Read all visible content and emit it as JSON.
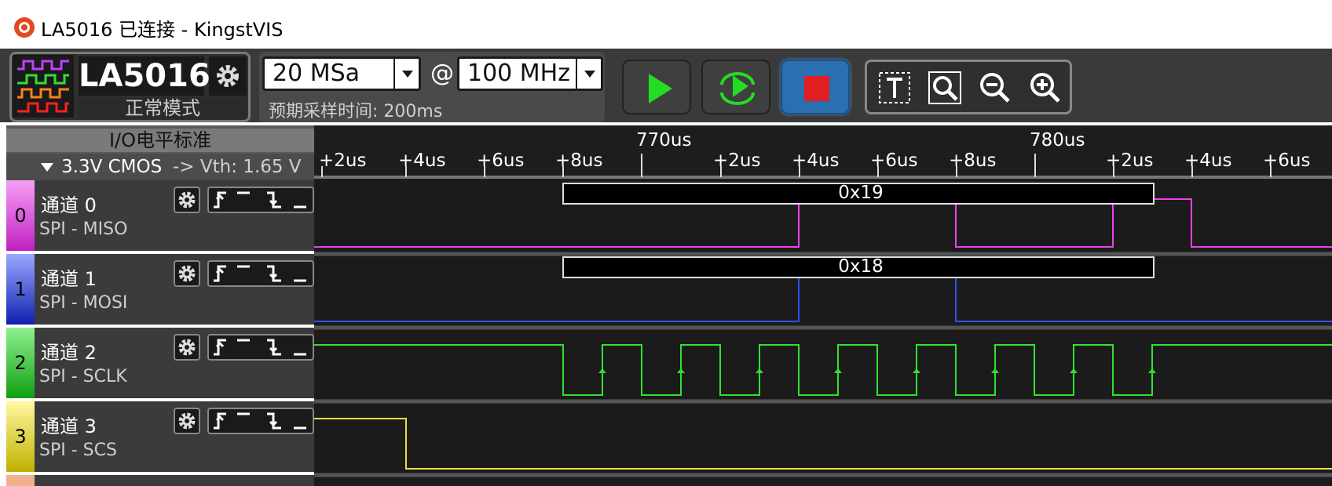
{
  "window": {
    "title": "LA5016 已连接 - KingstVIS"
  },
  "device": {
    "name": "LA5016",
    "mode": "正常模式"
  },
  "sampling": {
    "depth": "20 MSa",
    "at": "@",
    "rate": "100 MHz",
    "expected_time": "预期采样时间: 200ms"
  },
  "io": {
    "title": "I/O电平标准",
    "standard": "3.3V CMOS",
    "threshold": "-> Vth: 1.65 V"
  },
  "timeline": {
    "major": [
      "770us",
      "780us"
    ],
    "ticks": [
      "+2us",
      "+4us",
      "+6us",
      "+8us",
      "+2us",
      "+4us",
      "+6us",
      "+8us",
      "+2us",
      "+4us",
      "+6us"
    ]
  },
  "channels": [
    {
      "index": "0",
      "name": "通道 0",
      "protocol": "SPI - MISO",
      "color": "#f040f0",
      "decode": "0x19"
    },
    {
      "index": "1",
      "name": "通道 1",
      "protocol": "SPI - MOSI",
      "color": "#3050ff",
      "decode": "0x18"
    },
    {
      "index": "2",
      "name": "通道 2",
      "protocol": "SPI - SCLK",
      "color": "#30e030"
    },
    {
      "index": "3",
      "name": "通道 3",
      "protocol": "SPI - SCS",
      "color": "#f0e040"
    }
  ],
  "icons": {
    "run": "play-icon",
    "loop": "loop-capture-icon",
    "stop": "stop-icon",
    "zoom": [
      "text-select-icon",
      "zoom-search-icon",
      "zoom-out-icon",
      "zoom-in-icon"
    ]
  }
}
